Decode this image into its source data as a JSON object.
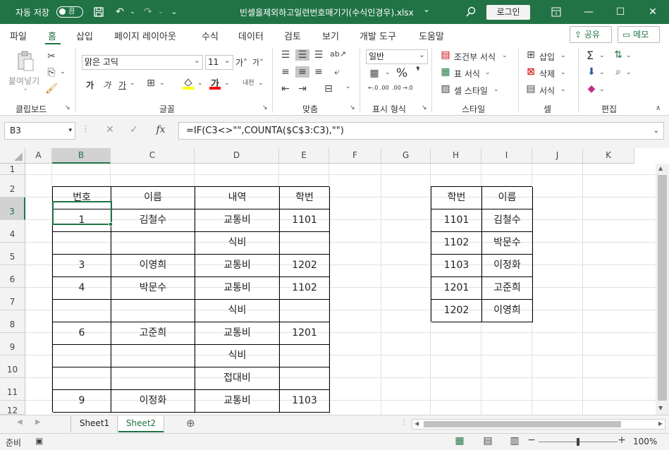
{
  "titlebar": {
    "autosave_label": "자동 저장",
    "autosave_state": "끔",
    "filename": "빈셀을제외하고일련번호매기기(수식인경우).xlsx",
    "filename_caret": "⌄",
    "login_label": "로그인"
  },
  "tabs": [
    "파일",
    "홈",
    "삽입",
    "페이지 레이아웃",
    "수식",
    "데이터",
    "검토",
    "보기",
    "개발 도구",
    "도움말"
  ],
  "active_tab": "홈",
  "share_label": "공유",
  "memo_label": "메모",
  "ribbon": {
    "paste_label": "붙여넣기",
    "font_name": "맑은 고딕",
    "font_size": "11",
    "grow_font": "가˄",
    "shrink_font": "가˅",
    "bold": "가",
    "italic": "가",
    "underline": "가",
    "font_color_glyph": "가",
    "phonetic": "내천",
    "number_format": "일반",
    "percent": "%",
    "comma": "❜",
    "dec_increase": "←.0 .00",
    "dec_decrease": ".00 →.0",
    "cond_format": "조건부 서식",
    "table_format": "표 서식",
    "cell_style": "셀 스타일",
    "insert": "삽입",
    "delete": "삭제",
    "format": "서식",
    "sum_glyph": "Σ",
    "groups": [
      "클립보드",
      "글꼴",
      "맞춤",
      "표시 형식",
      "스타일",
      "셀",
      "편집"
    ]
  },
  "formula_bar": {
    "name_box": "B3",
    "formula": "=IF(C3<>\"\",COUNTA($C$3:C3),\"\")"
  },
  "columns": [
    "A",
    "B",
    "C",
    "D",
    "E",
    "F",
    "G",
    "H",
    "I",
    "J",
    "K"
  ],
  "selected_column": "B",
  "rows": [
    "1",
    "2",
    "3",
    "4",
    "5",
    "6",
    "7",
    "8",
    "9",
    "10",
    "11",
    "12"
  ],
  "selected_row": "3",
  "main_table": {
    "headers": [
      "번호",
      "이름",
      "내역",
      "학번"
    ],
    "rows": [
      [
        "1",
        "김철수",
        "교통비",
        "1101"
      ],
      [
        "",
        "",
        "식비",
        ""
      ],
      [
        "3",
        "이영희",
        "교통비",
        "1202"
      ],
      [
        "4",
        "박문수",
        "교통비",
        "1102"
      ],
      [
        "",
        "",
        "식비",
        ""
      ],
      [
        "6",
        "고준희",
        "교통비",
        "1201"
      ],
      [
        "",
        "",
        "식비",
        ""
      ],
      [
        "",
        "",
        "접대비",
        ""
      ],
      [
        "9",
        "이정화",
        "교통비",
        "1103"
      ]
    ]
  },
  "lookup_table": {
    "headers": [
      "학번",
      "이름"
    ],
    "rows": [
      [
        "1101",
        "김철수"
      ],
      [
        "1102",
        "박문수"
      ],
      [
        "1103",
        "이정화"
      ],
      [
        "1201",
        "고준희"
      ],
      [
        "1202",
        "이영희"
      ]
    ]
  },
  "sheets": [
    "Sheet1",
    "Sheet2"
  ],
  "active_sheet": "Sheet2",
  "status": {
    "ready": "준비",
    "zoom": "100%"
  },
  "colors": {
    "accent": "#217346",
    "grid_line": "#e1e1e1",
    "header_bg": "#f3f3f3"
  }
}
